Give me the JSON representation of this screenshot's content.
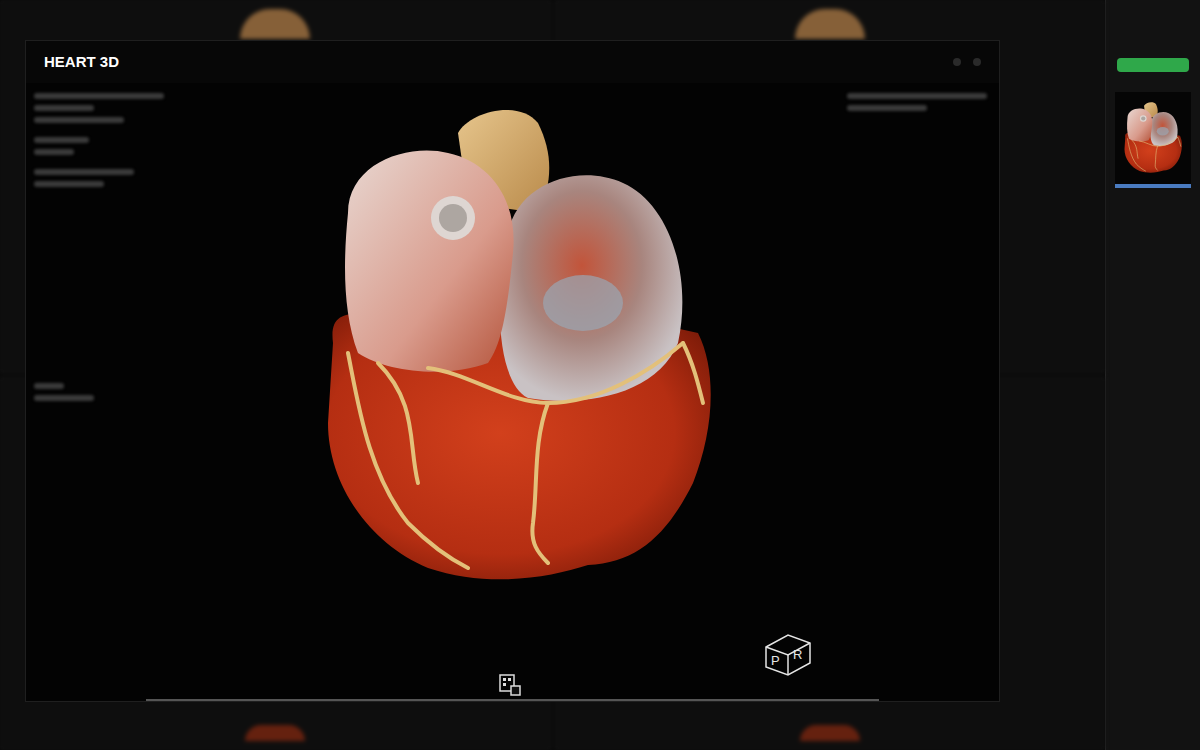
{
  "window": {
    "title": "HEART 3D"
  },
  "orientation_cube": {
    "faces": [
      "P",
      "R"
    ]
  },
  "sidebar": {
    "status_bar": {
      "level": 1
    },
    "thumbnails": [
      {
        "selected": true
      }
    ]
  }
}
